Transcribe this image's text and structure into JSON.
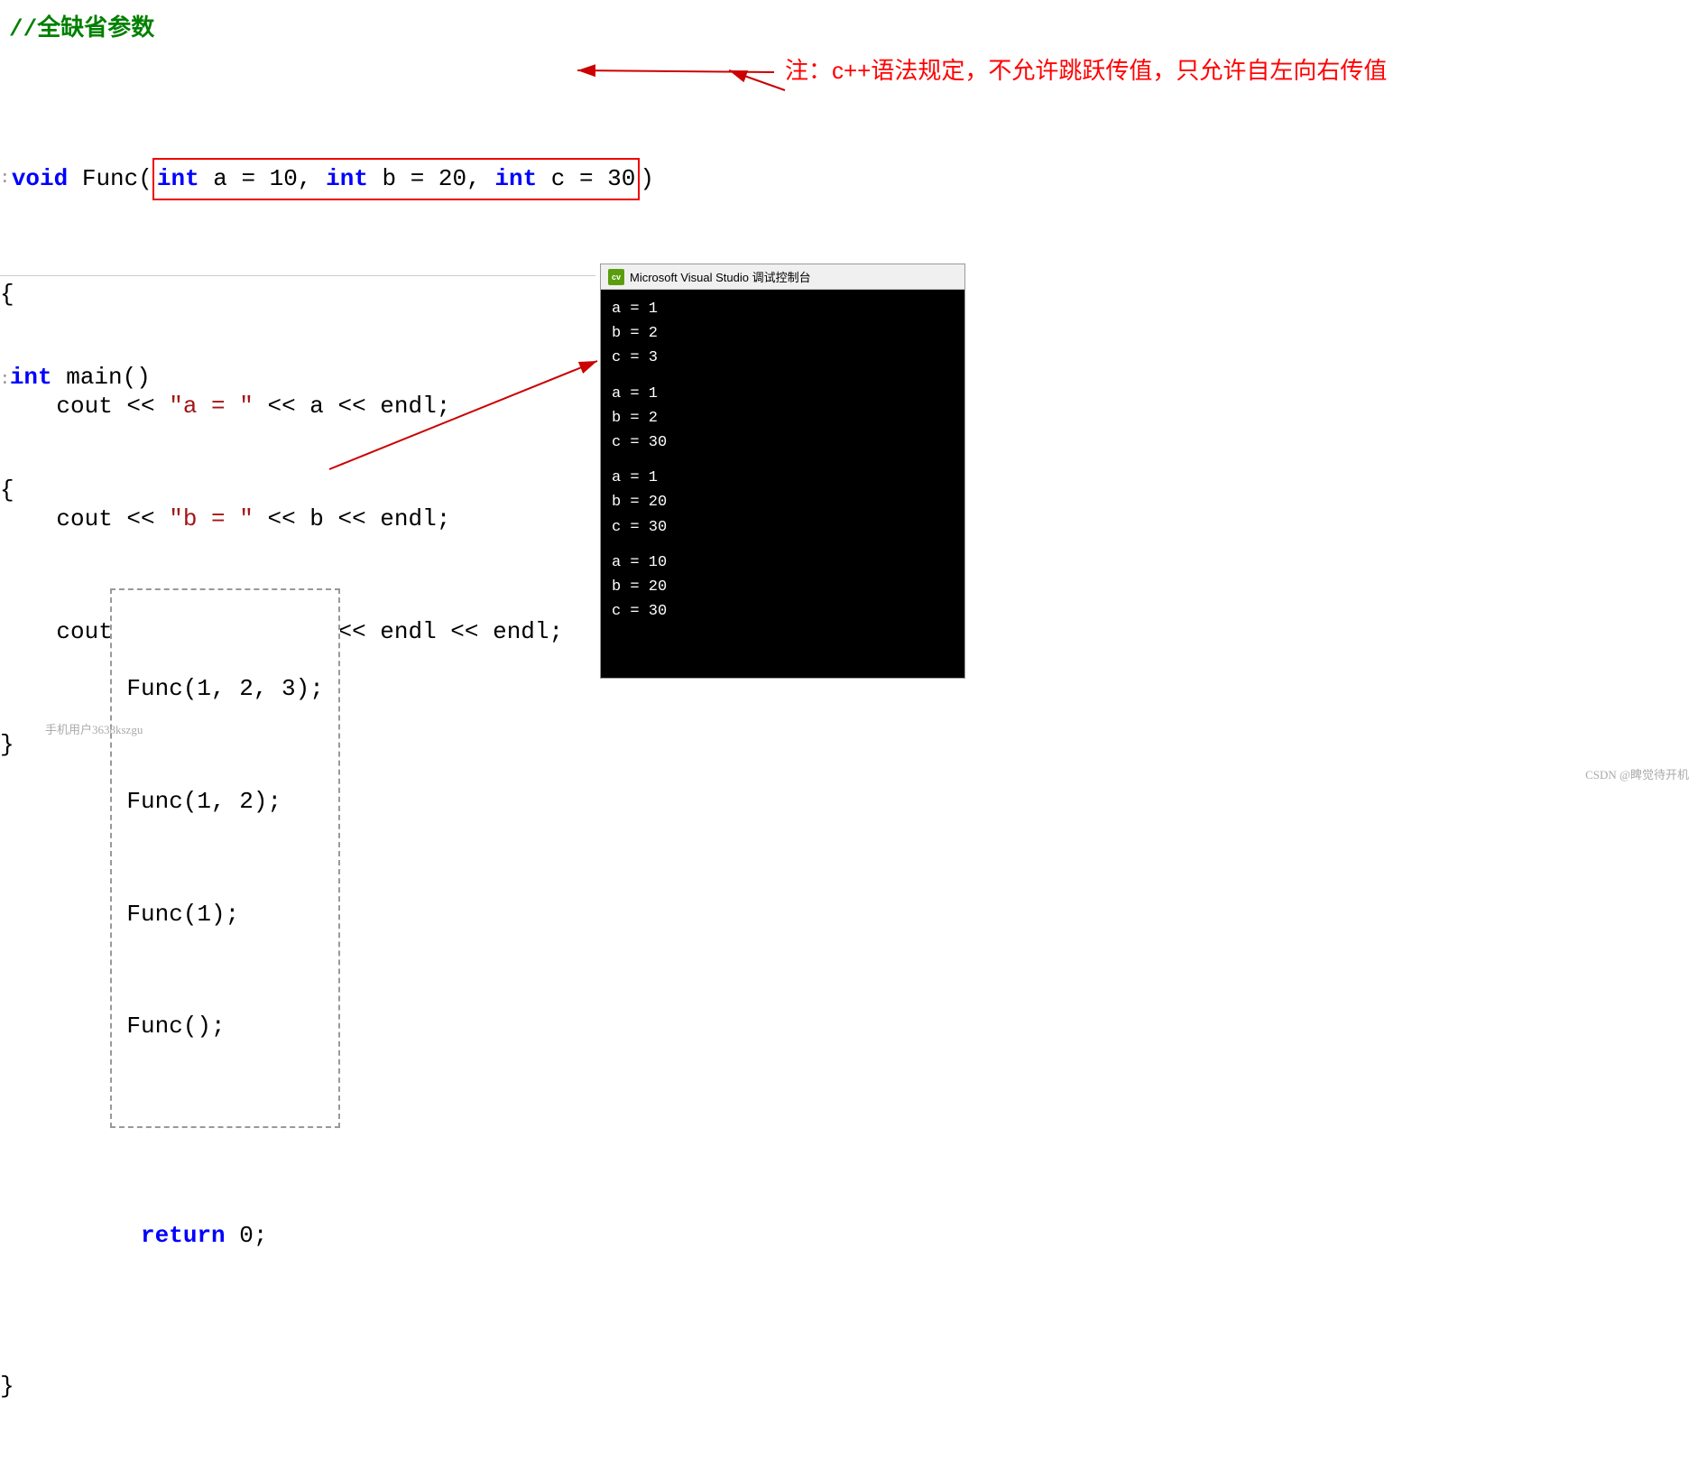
{
  "comment": "//全缺省参数",
  "func_def": {
    "line1_pre": "void Func(",
    "line1_params": "int a = 10, int b = 20, int c = 30",
    "line1_post": ")",
    "line2": "{",
    "line3": "    cout << \"a = \" << a << endl;",
    "line4": "    cout << \"b = \" << b << endl;",
    "line5": "    cout << \"c = \" << c << endl << endl;",
    "line6": "}"
  },
  "main_func": {
    "line1_marker": ":",
    "line1": "int main()",
    "line2": "{",
    "calls_box": [
      "Func(1, 2, 3);",
      "Func(1, 2);",
      "Func(1);",
      "Func();"
    ],
    "line_return": "    return 0;",
    "line_end": "}"
  },
  "note": "注：c++语法规定，不允许跳跃传值，只允许自左向右传值",
  "console": {
    "title": "Microsoft Visual Studio 调试控制台",
    "output": [
      "a = 1",
      "b = 2",
      "c = 3",
      "",
      "a = 1",
      "b = 2",
      "c = 30",
      "",
      "a = 1",
      "b = 20",
      "c = 30",
      "",
      "a = 10",
      "b = 20",
      "c = 30"
    ]
  },
  "watermark": "CSDN @睥觉待开机",
  "author": "手机用户3638kszgu"
}
